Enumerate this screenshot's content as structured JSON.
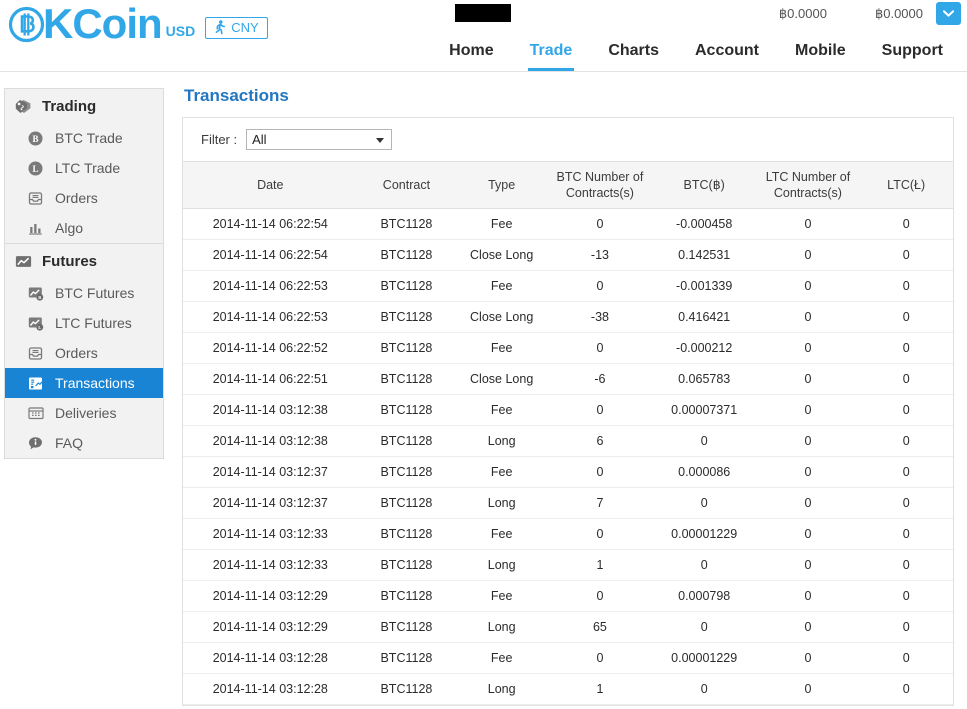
{
  "colors": {
    "brand_blue": "#32a7e8",
    "sidebar_active": "#1a84d4",
    "title_blue": "#2277c0",
    "long_green": "#1e7a1e",
    "close_long_red": "#f01414",
    "tab_orange": "#f36c00"
  },
  "header": {
    "logo_text": "KCoin",
    "logo_icon": "bitcoin-b-icon",
    "currency_usd": "USD",
    "currency_toggle": "CNY",
    "currency_toggle_icon": "running-person-icon",
    "dropdown_icon": "chevron-down-icon",
    "balances": [
      {
        "label": "฿0.0000"
      },
      {
        "label": "฿0.0000"
      }
    ],
    "nav": [
      {
        "label": "Home",
        "active": false
      },
      {
        "label": "Trade",
        "active": true
      },
      {
        "label": "Charts",
        "active": false
      },
      {
        "label": "Account",
        "active": false
      },
      {
        "label": "Mobile",
        "active": false
      },
      {
        "label": "Support",
        "active": false
      }
    ]
  },
  "sidebar": {
    "groups": [
      {
        "title": "Trading",
        "icon": "price-tags-icon",
        "items": [
          {
            "label": "BTC Trade",
            "icon": "bitcoin-coin-icon",
            "active": false
          },
          {
            "label": "LTC Trade",
            "icon": "litecoin-coin-icon",
            "active": false
          },
          {
            "label": "Orders",
            "icon": "inbox-icon",
            "active": false
          },
          {
            "label": "Algo",
            "icon": "bar-chart-icon",
            "active": false
          }
        ]
      },
      {
        "title": "Futures",
        "icon": "trend-line-icon",
        "items": [
          {
            "label": "BTC Futures",
            "icon": "bitcoin-futures-icon",
            "active": false
          },
          {
            "label": "LTC Futures",
            "icon": "litecoin-futures-icon",
            "active": false
          },
          {
            "label": "Orders",
            "icon": "inbox-icon",
            "active": false
          },
          {
            "label": "Transactions",
            "icon": "transactions-icon",
            "active": true
          },
          {
            "label": "Deliveries",
            "icon": "calendar-grid-icon",
            "active": false
          },
          {
            "label": "FAQ",
            "icon": "info-bubble-icon",
            "active": false
          }
        ]
      }
    ]
  },
  "main": {
    "page_title": "Transactions",
    "filter": {
      "label": "Filter :",
      "value": "All",
      "caret_icon": "caret-down-icon"
    },
    "table": {
      "columns": [
        {
          "key": "date",
          "label": "Date"
        },
        {
          "key": "contract",
          "label": "Contract"
        },
        {
          "key": "type",
          "label": "Type"
        },
        {
          "key": "btc_contracts",
          "label": "BTC Number of Contracts(s)"
        },
        {
          "key": "btc",
          "label": "BTC(฿)"
        },
        {
          "key": "ltc_contracts",
          "label": "LTC Number of Contracts(s)"
        },
        {
          "key": "ltc",
          "label": "LTC(Ł)"
        }
      ],
      "rows": [
        {
          "date": "2014-11-14 06:22:54",
          "contract": "BTC1128",
          "type": "Fee",
          "type_class": "fee",
          "btc_contracts": "0",
          "btc": "-0.000458",
          "ltc_contracts": "0",
          "ltc": "0"
        },
        {
          "date": "2014-11-14 06:22:54",
          "contract": "BTC1128",
          "type": "Close Long",
          "type_class": "closelong",
          "btc_contracts": "-13",
          "btc": "0.142531",
          "ltc_contracts": "0",
          "ltc": "0"
        },
        {
          "date": "2014-11-14 06:22:53",
          "contract": "BTC1128",
          "type": "Fee",
          "type_class": "fee",
          "btc_contracts": "0",
          "btc": "-0.001339",
          "ltc_contracts": "0",
          "ltc": "0"
        },
        {
          "date": "2014-11-14 06:22:53",
          "contract": "BTC1128",
          "type": "Close Long",
          "type_class": "closelong",
          "btc_contracts": "-38",
          "btc": "0.416421",
          "ltc_contracts": "0",
          "ltc": "0"
        },
        {
          "date": "2014-11-14 06:22:52",
          "contract": "BTC1128",
          "type": "Fee",
          "type_class": "fee",
          "btc_contracts": "0",
          "btc": "-0.000212",
          "ltc_contracts": "0",
          "ltc": "0"
        },
        {
          "date": "2014-11-14 06:22:51",
          "contract": "BTC1128",
          "type": "Close Long",
          "type_class": "closelong",
          "btc_contracts": "-6",
          "btc": "0.065783",
          "ltc_contracts": "0",
          "ltc": "0"
        },
        {
          "date": "2014-11-14 03:12:38",
          "contract": "BTC1128",
          "type": "Fee",
          "type_class": "fee",
          "btc_contracts": "0",
          "btc": "0.00007371",
          "ltc_contracts": "0",
          "ltc": "0"
        },
        {
          "date": "2014-11-14 03:12:38",
          "contract": "BTC1128",
          "type": "Long",
          "type_class": "long",
          "btc_contracts": "6",
          "btc": "0",
          "ltc_contracts": "0",
          "ltc": "0"
        },
        {
          "date": "2014-11-14 03:12:37",
          "contract": "BTC1128",
          "type": "Fee",
          "type_class": "fee",
          "btc_contracts": "0",
          "btc": "0.000086",
          "ltc_contracts": "0",
          "ltc": "0"
        },
        {
          "date": "2014-11-14 03:12:37",
          "contract": "BTC1128",
          "type": "Long",
          "type_class": "long",
          "btc_contracts": "7",
          "btc": "0",
          "ltc_contracts": "0",
          "ltc": "0"
        },
        {
          "date": "2014-11-14 03:12:33",
          "contract": "BTC1128",
          "type": "Fee",
          "type_class": "fee",
          "btc_contracts": "0",
          "btc": "0.00001229",
          "ltc_contracts": "0",
          "ltc": "0"
        },
        {
          "date": "2014-11-14 03:12:33",
          "contract": "BTC1128",
          "type": "Long",
          "type_class": "long",
          "btc_contracts": "1",
          "btc": "0",
          "ltc_contracts": "0",
          "ltc": "0"
        },
        {
          "date": "2014-11-14 03:12:29",
          "contract": "BTC1128",
          "type": "Fee",
          "type_class": "fee",
          "btc_contracts": "0",
          "btc": "0.000798",
          "ltc_contracts": "0",
          "ltc": "0"
        },
        {
          "date": "2014-11-14 03:12:29",
          "contract": "BTC1128",
          "type": "Long",
          "type_class": "long",
          "btc_contracts": "65",
          "btc": "0",
          "ltc_contracts": "0",
          "ltc": "0"
        },
        {
          "date": "2014-11-14 03:12:28",
          "contract": "BTC1128",
          "type": "Fee",
          "type_class": "fee",
          "btc_contracts": "0",
          "btc": "0.00001229",
          "ltc_contracts": "0",
          "ltc": "0"
        },
        {
          "date": "2014-11-14 03:12:28",
          "contract": "BTC1128",
          "type": "Long",
          "type_class": "long",
          "btc_contracts": "1",
          "btc": "0",
          "ltc_contracts": "0",
          "ltc": "0"
        }
      ]
    }
  }
}
